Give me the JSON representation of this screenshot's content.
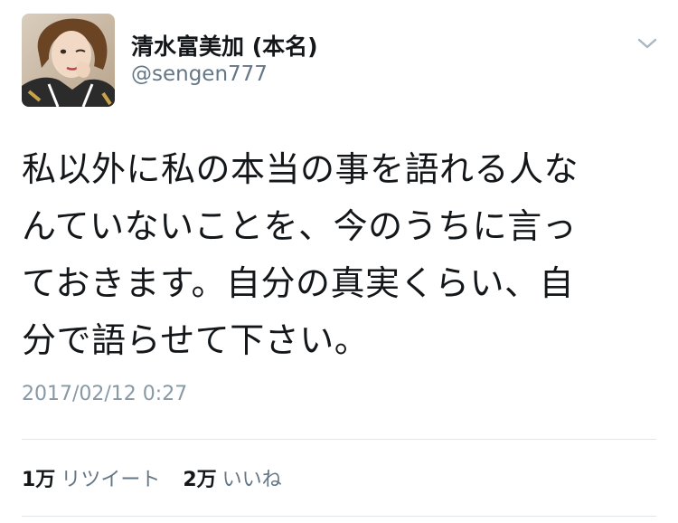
{
  "user": {
    "display_name": "清水富美加 (本名)",
    "handle": "@sengen777",
    "avatar_icon": "profile-photo"
  },
  "tweet": {
    "lines": [
      "私以外に私の本当の事を語れる人な",
      "んていないことを、今のうちに言っ",
      "ておきます。自分の真実くらい、自",
      "分で語らせて下さい。"
    ],
    "timestamp": "2017/02/12 0:27"
  },
  "stats": {
    "retweets_count": "1万",
    "retweets_label": "リツイート",
    "likes_count": "2万",
    "likes_label": "いいね"
  },
  "menu_icon": "chevron-down-icon",
  "colors": {
    "text_primary": "#14171a",
    "text_secondary": "#657786",
    "timestamp": "#8899a6",
    "divider": "#e1e8ed"
  }
}
